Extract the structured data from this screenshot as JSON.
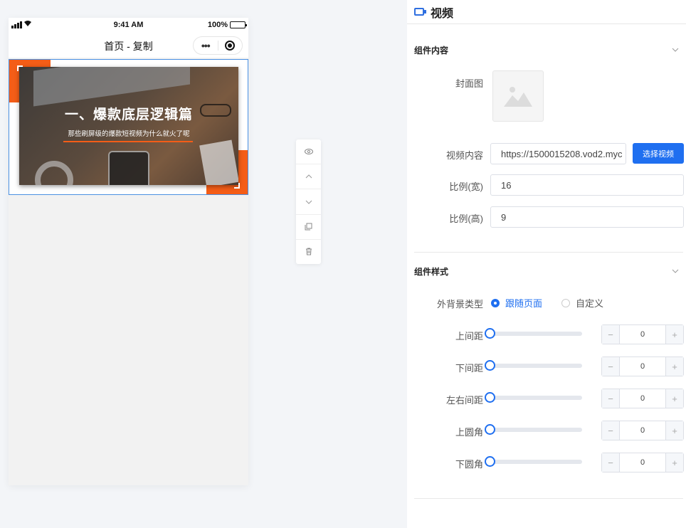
{
  "status_bar": {
    "time": "9:41 AM",
    "battery": "100%"
  },
  "mini_app": {
    "title": "首页 - 复制",
    "more": "•••"
  },
  "banner": {
    "title": "一、爆款底层逻辑篇",
    "subtitle": "那些刷屏级的爆款短视频为什么就火了呢"
  },
  "panel": {
    "header": "视频",
    "content_section": {
      "title": "组件内容",
      "cover_label": "封面图",
      "video_label": "视频内容",
      "video_url": "https://1500015208.vod2.myc",
      "choose_button": "选择视频",
      "width_label": "比例(宽)",
      "width_value": "16",
      "height_label": "比例(高)",
      "height_value": "9"
    },
    "style_section": {
      "title": "组件样式",
      "bg_label": "外背景类型",
      "bg_options": [
        "跟随页面",
        "自定义"
      ],
      "bg_selected": "跟随页面",
      "sliders": [
        {
          "label": "上间距",
          "value": "0"
        },
        {
          "label": "下间距",
          "value": "0"
        },
        {
          "label": "左右间距",
          "value": "0"
        },
        {
          "label": "上圆角",
          "value": "0"
        },
        {
          "label": "下圆角",
          "value": "0"
        }
      ],
      "minus": "−",
      "plus": "+"
    }
  },
  "colors": {
    "accent": "#1f6ff0",
    "orange": "#f45d17",
    "selection": "#4a90e2"
  },
  "icons": {
    "side_tools": [
      "eye-icon",
      "chevron-up-icon",
      "chevron-down-icon",
      "copy-icon",
      "trash-icon"
    ]
  }
}
